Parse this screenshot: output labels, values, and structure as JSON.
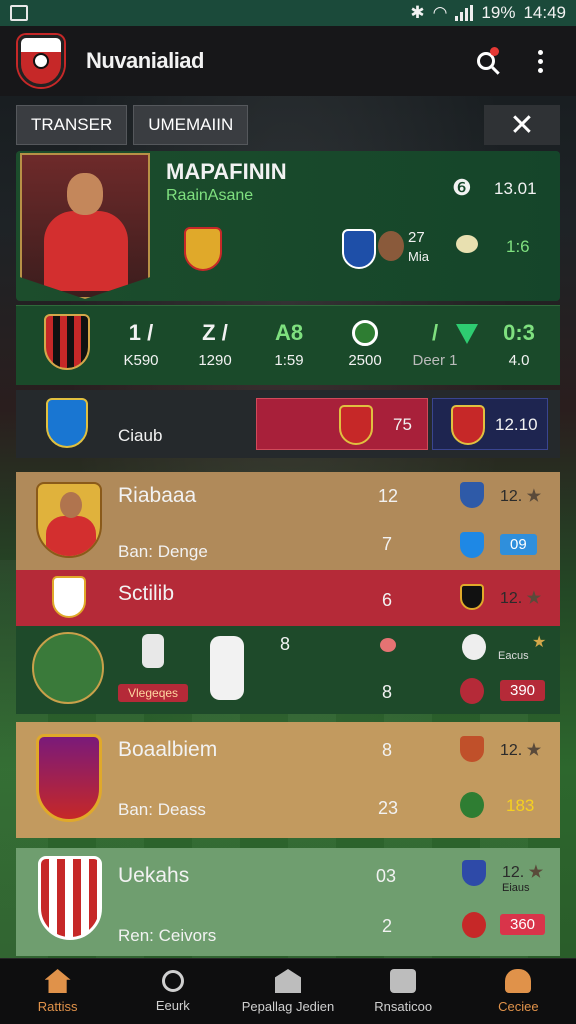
{
  "status_bar": {
    "battery": "19%",
    "time": "14:49"
  },
  "app_bar": {
    "title": "Nuvanialiad"
  },
  "tabs": [
    {
      "label": "TRANSER"
    },
    {
      "label": "UMEMAIIN"
    }
  ],
  "player": {
    "name": "MAPAFININ",
    "subtitle": "RaainAsane",
    "stat_a": "27",
    "stat_a_sub": "Mia",
    "val1": "13.01",
    "val2": "1:6"
  },
  "stats_row": [
    {
      "top": "1 /",
      "bot": "K590"
    },
    {
      "top": "Z /",
      "bot": "1290"
    },
    {
      "top": "A8",
      "bot": "1:59"
    },
    {
      "top": "",
      "bot": "2500"
    },
    {
      "top": "/",
      "bot": "Deer 1"
    },
    {
      "top": "0:3",
      "bot": "4.0"
    }
  ],
  "club_bar": {
    "label": "Ciaub",
    "val1": "75",
    "val2": "12.10"
  },
  "list": [
    {
      "name": "Riabaaa",
      "sub": "Ban: Denge",
      "num1": "12",
      "num2": "7",
      "rating": "12.",
      "pill": "09"
    },
    {
      "name": "Sctilib",
      "num": "6",
      "rating": "12."
    },
    {
      "tag": "Vlegeqes",
      "num1": "8",
      "num2": "8",
      "mini_label": "Eacus",
      "pill": "390"
    },
    {
      "name": "Boaalbiem",
      "sub": "Ban: Deass",
      "num1": "8",
      "num2": "23",
      "rating": "12.",
      "pill": "183"
    },
    {
      "name": "Uekahs",
      "sub": "Ren: Ceivors",
      "num1": "03",
      "num2": "2",
      "rating": "12.",
      "mini_label": "Eiaus",
      "pill": "360"
    }
  ],
  "bottom_nav": [
    {
      "label": "Rattiss"
    },
    {
      "label": "Eeurk"
    },
    {
      "label": "Pepallag Jedien"
    },
    {
      "label": "Rnsaticoo"
    },
    {
      "label": "Ceciee"
    }
  ]
}
